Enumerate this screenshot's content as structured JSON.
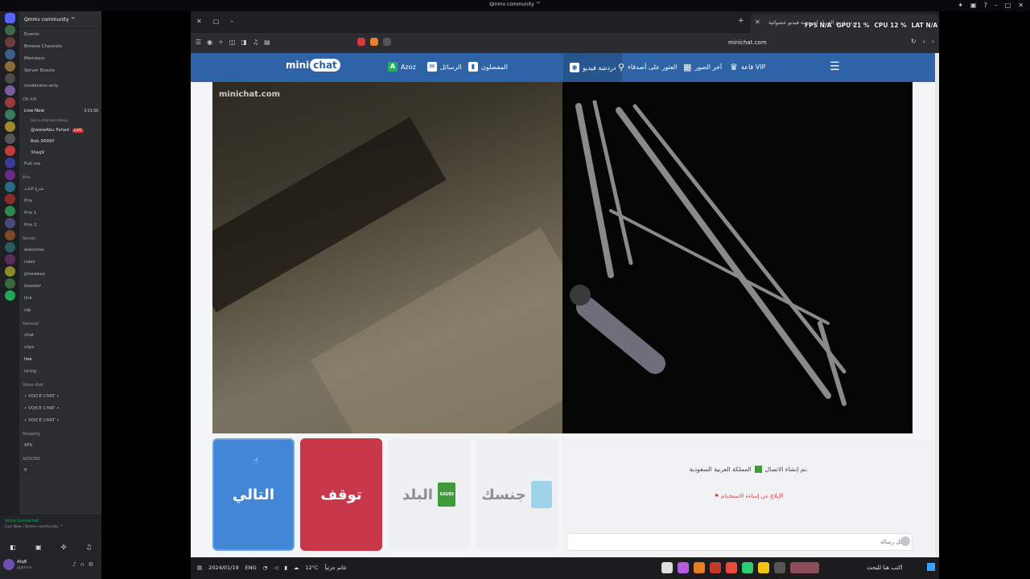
{
  "window": {
    "title": "Qmmv community ™"
  },
  "discord": {
    "server_name": "Qmmv community ™",
    "top_items": [
      "Events",
      "Browse Channels",
      "Members",
      "Server Boosts"
    ],
    "moderator": "moderator-only",
    "on_air": {
      "category": "ON AIR",
      "live_channel": "Live Now",
      "live_time": "2:11:50",
      "status_hint": "Set a channel status",
      "members": [
        {
          "name": "@wwwAbu Fahad",
          "badge": "LIVE"
        },
        {
          "name": "Bob 9999Y",
          "badge": ""
        },
        {
          "name": "3ilaq9",
          "badge": ""
        }
      ],
      "pull": "Pull me"
    },
    "priv": {
      "category": "Priv",
      "channels": [
        "شرع الناب",
        "Priv",
        "Priv 1",
        "Priv 2"
      ]
    },
    "server": {
      "category": "Server",
      "channels": [
        "welcome",
        "rules",
        "giveaway",
        "booster",
        "link",
        "vip"
      ]
    },
    "general": {
      "category": "General",
      "channels": [
        "chat",
        "clips",
        "live",
        "id-trg"
      ]
    },
    "voice": {
      "category": "Voice chat",
      "channels": [
        "• VOICE CHAT •",
        "• VOICE CHAT •",
        "• VOICE CHAT •"
      ]
    },
    "sleeping": {
      "category": "Sleeping",
      "channels": [
        "AFK"
      ]
    },
    "addons": {
      "category": "ADDONS",
      "channels": [
        "fl"
      ]
    },
    "voice_status": {
      "title": "Voice Connected",
      "sub": "Live Now / Qmmv community ™"
    },
    "user": {
      "name": "Alq8",
      "status": "@jbhnm"
    }
  },
  "browser": {
    "tab_title": "دردشة مع الغرباء | دردشة فيديو عشوائية",
    "url": "minichat.com"
  },
  "hud": {
    "fps": "FPS N/A",
    "gpu": "GPU 21 %",
    "cpu": "CPU 12 %",
    "lat": "LAT N/A"
  },
  "site": {
    "logo_main": "mini",
    "logo_bubble": "chat",
    "nav": {
      "azoz": "Azoz",
      "messages": "الرسائل",
      "favorites": "المفضلون",
      "video_chat": "دردشة فيديو",
      "search": "العثور على أصدقاء",
      "photos": "آخر الصور",
      "vip": "قاعة VIP"
    },
    "watermark": "minichat.com"
  },
  "controls": {
    "next": "التالي",
    "stop": "توقف",
    "country": "البلد",
    "country_flag_text": "SAUDI",
    "gender": "جنسك"
  },
  "chat": {
    "connection_msg": "تم إنشاء الاتصال.",
    "country": "المملكة العربية السعودية",
    "report": "الإبلاغ عن إساءة الاستخدام",
    "input_placeholder": "أدخل رسالة"
  },
  "taskbar": {
    "date": "2024/01/19",
    "lang": "ENG",
    "weather": "12°C",
    "weather_text": "غائم جزئياً",
    "search": "اكتب هنا للبحث"
  },
  "colors": {
    "nav_blue": "#2f63a8",
    "next_blue": "#4287d6",
    "stop_red": "#c8384a",
    "discord_bg": "#2b2d31"
  }
}
